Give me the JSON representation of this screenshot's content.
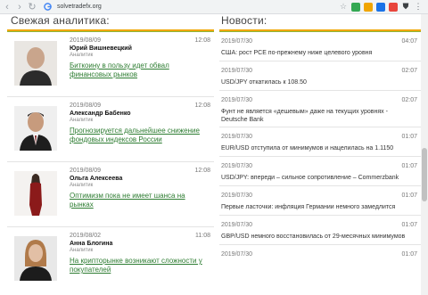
{
  "browser": {
    "url": "solvetradefx.org",
    "ext_colors": [
      "#34a853",
      "#f0a500",
      "#1a73e8",
      "#e8453c",
      "#5f6368",
      "#5f6368"
    ]
  },
  "left_section": {
    "title": "Свежая аналитика:"
  },
  "right_section": {
    "title": "Новости:"
  },
  "analytics": [
    {
      "date": "2019/08/09",
      "time": "12:08",
      "name": "Юрий Вишневецкий",
      "role": "Аналитик",
      "title": "Биткоину в пользу идет обвал финансовых рынков"
    },
    {
      "date": "2019/08/09",
      "time": "12:08",
      "name": "Александр Бабенко",
      "role": "Аналитик",
      "title": "Прогнозируется дальнейшее снижение фондовых индексов России"
    },
    {
      "date": "2019/08/09",
      "time": "12:08",
      "name": "Ольга Алексеева",
      "role": "Аналитик",
      "title": "Оптимизм пока не имеет шанса на рынках"
    },
    {
      "date": "2019/08/02",
      "time": "11:08",
      "name": "Анна Блогина",
      "role": "Аналитик",
      "title": "На крипторынке возникают сложности у покупателей"
    }
  ],
  "news": [
    {
      "date": "2019/07/30",
      "time": "04:07",
      "text": "США: рост PCE по-прежнему ниже целевого уровня",
      "tall": false
    },
    {
      "date": "2019/07/30",
      "time": "02:07",
      "text": "USD/JPY откатилась к 108.50",
      "tall": false
    },
    {
      "date": "2019/07/30",
      "time": "02:07",
      "text": "Фунт не является «дешевым» даже на текущих уровнях - Deutsche Bank",
      "tall": true
    },
    {
      "date": "2019/07/30",
      "time": "01:07",
      "text": "EUR/USD отступила от минимумов и нацелилась на 1.1150",
      "tall": false
    },
    {
      "date": "2019/07/30",
      "time": "01:07",
      "text": "USD/JPY: впереди – сильное сопротивление – Commerzbank",
      "tall": false
    },
    {
      "date": "2019/07/30",
      "time": "01:07",
      "text": "Первые ласточки: инфляция Германии немного замедлится",
      "tall": false
    },
    {
      "date": "2019/07/30",
      "time": "01:07",
      "text": "GBP/USD немного восстановилась от 29-месячных минимумов",
      "tall": false
    },
    {
      "date": "2019/07/30",
      "time": "01:07",
      "text": "",
      "tall": false
    }
  ]
}
